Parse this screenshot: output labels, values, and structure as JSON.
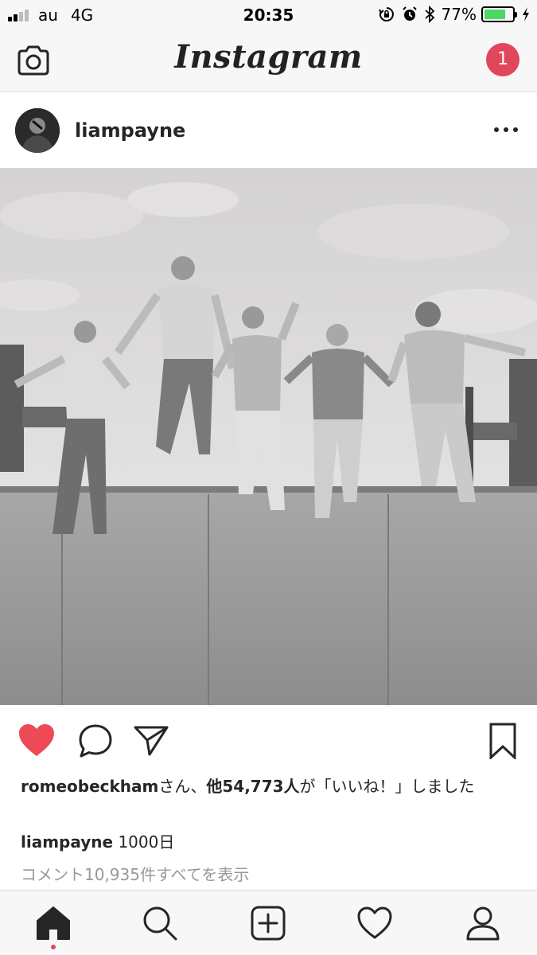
{
  "status_bar": {
    "carrier": "au",
    "network": "4G",
    "time": "20:35",
    "battery_percent": "77%",
    "battery_level": 0.77,
    "icons": [
      "signal-icon",
      "rotation-lock-icon",
      "alarm-icon",
      "bluetooth-icon",
      "battery-icon",
      "charging-icon"
    ]
  },
  "header": {
    "logo_text": "Instagram",
    "notification_count": "1",
    "camera_icon": "camera-icon"
  },
  "post": {
    "username": "liampayne",
    "more_icon": "more-options-icon",
    "photo_alt": "black-and-white photo",
    "liked": true,
    "likes_user": "romeobeckham",
    "likes_mid": "さん、",
    "likes_count": "他54,773人",
    "likes_end": "が「いいね！」しました",
    "caption_user": "liampayne",
    "caption_text": "1000日",
    "view_comments": "コメント10,935件すべてを表示"
  },
  "colors": {
    "like_red": "#ed4956",
    "badge_red": "#e0475a",
    "battery_green": "#4cd964",
    "muted_text": "#999999"
  },
  "tabs": [
    {
      "icon": "home-icon"
    },
    {
      "icon": "search-icon"
    },
    {
      "icon": "add-post-icon"
    },
    {
      "icon": "activity-heart-icon"
    },
    {
      "icon": "profile-icon"
    }
  ]
}
